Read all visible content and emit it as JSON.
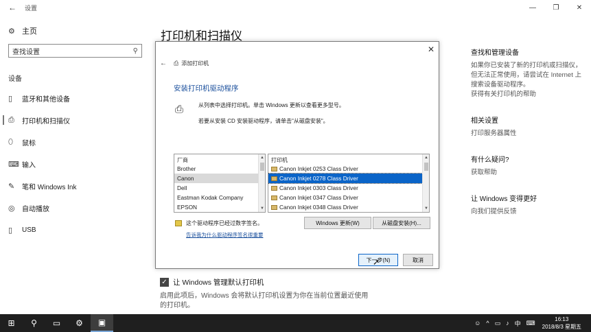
{
  "window": {
    "title": "设置",
    "controls": [
      "—",
      "❐",
      "✕"
    ]
  },
  "sidebar": {
    "home_label": "主页",
    "search_placeholder": "查找设置",
    "section_label": "设备",
    "items": [
      {
        "label": "蓝牙和其他设备",
        "icon": "bluetooth-devices-icon"
      },
      {
        "label": "打印机和扫描仪",
        "icon": "printer-icon"
      },
      {
        "label": "鼠标",
        "icon": "mouse-icon"
      },
      {
        "label": "输入",
        "icon": "keyboard-icon"
      },
      {
        "label": "笔和 Windows Ink",
        "icon": "pen-icon"
      },
      {
        "label": "自动播放",
        "icon": "autoplay-icon"
      },
      {
        "label": "USB",
        "icon": "usb-icon"
      }
    ]
  },
  "main": {
    "title": "打印机和扫描仪",
    "checkbox_label": "让 Windows 管理默认打印机",
    "checkbox_checked": true,
    "checkbox_desc": "启用此项后，Windows 会将默认打印机设置为你在当前位置最近使用的打印机。"
  },
  "right": {
    "find": {
      "heading": "查找和管理设备",
      "body": "如果你已安装了新的打印机或扫描仪，但无法正常使用，请尝试在 Internet 上搜索设备驱动程序。",
      "link": "获得有关打印机的帮助"
    },
    "related": {
      "heading": "相关设置",
      "link": "打印服务器属性"
    },
    "question": {
      "heading": "有什么疑问?",
      "link": "获取帮助"
    },
    "better": {
      "heading": "让 Windows 变得更好",
      "link": "向我们提供反馈"
    }
  },
  "dialog": {
    "nav_title": "添加打印机",
    "heading": "安装打印机驱动程序",
    "text1": "从列表中选择打印机。单击 Windows 更新以查看更多型号。",
    "text2": "若要从安装 CD 安装驱动程序，请单击\"从磁盘安装\"。",
    "manufacturer": {
      "header": "厂商",
      "items": [
        "Brother",
        "Canon",
        "Dell",
        "Eastman Kodak Company",
        "EPSON"
      ],
      "selected": 1
    },
    "printers": {
      "header": "打印机",
      "items": [
        "Canon Inkjet 0253 Class Driver",
        "Canon Inkjet 0278 Class Driver",
        "Canon Inkjet 0303 Class Driver",
        "Canon Inkjet 0347 Class Driver",
        "Canon Inkjet 0348 Class Driver"
      ],
      "selected": 1
    },
    "signed_text": "这个驱动程序已经过数字签名。",
    "signing_link": "告诉我为什么驱动程序签名很重要",
    "windows_update_button": "Windows 更新(W)",
    "have_disk_button": "从磁盘安装(H)...",
    "next_button": "下一步(N)",
    "cancel_button": "取消"
  },
  "taskbar": {
    "time": "16:13",
    "date": "2018/8/3 星期五",
    "ime": "中"
  }
}
